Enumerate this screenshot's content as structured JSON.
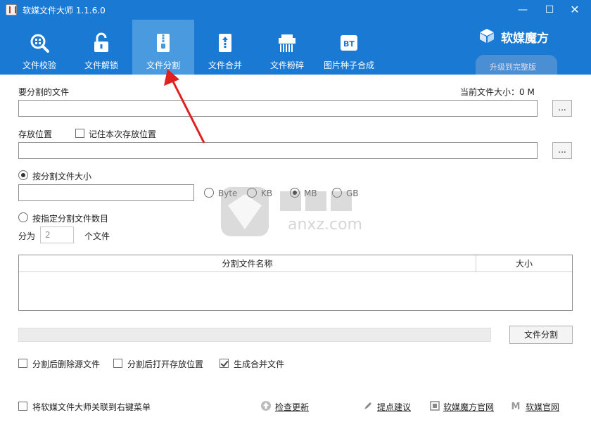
{
  "window": {
    "title": "软媒文件大师 1.1.6.0",
    "minimize": "—",
    "maximize": "☐",
    "close": "✕"
  },
  "tabs": [
    {
      "label": "文件校验",
      "icon": "magnifier-icon"
    },
    {
      "label": "文件解锁",
      "icon": "unlock-icon"
    },
    {
      "label": "文件分割",
      "icon": "zip-file-icon",
      "active": true
    },
    {
      "label": "文件合并",
      "icon": "merge-file-icon"
    },
    {
      "label": "文件粉碎",
      "icon": "shredder-icon"
    },
    {
      "label": "图片种子合成",
      "icon": "bt-icon"
    }
  ],
  "brand": {
    "name": "软媒魔方",
    "upgrade": "升级到完整版"
  },
  "form": {
    "source_label": "要分割的文件",
    "current_size": "当前文件大小：0 M",
    "browse": "...",
    "dest_label": "存放位置",
    "remember_label": "记住本次存放位置",
    "by_size_label": "按分割文件大小",
    "units": [
      "Byte",
      "KB",
      "MB",
      "GB"
    ],
    "selected_unit": "MB",
    "by_count_label": "按指定分割文件数目",
    "split_into": "分为",
    "count_value": "2",
    "count_suffix": "个文件"
  },
  "table": {
    "col_name": "分割文件名称",
    "col_size": "大小"
  },
  "actions": {
    "split_button": "文件分割",
    "opt_delete_source": "分割后删除源文件",
    "opt_open_folder": "分割后打开存放位置",
    "opt_create_merge": "生成合并文件",
    "opt_context_menu": "将软媒文件大师关联到右键菜单"
  },
  "footer_links": [
    {
      "label": "检查更新",
      "icon": "update-icon"
    },
    {
      "label": "提点建议",
      "icon": "feedback-icon"
    },
    {
      "label": "软媒魔方官网",
      "icon": "cube-icon"
    },
    {
      "label": "软媒官网",
      "icon": "m-logo-icon"
    }
  ],
  "watermark": {
    "text": "anxz.com"
  },
  "colors": {
    "header": "#1a7ad3",
    "active_tab": "#4a9ae0",
    "arrow": "#e02020"
  }
}
